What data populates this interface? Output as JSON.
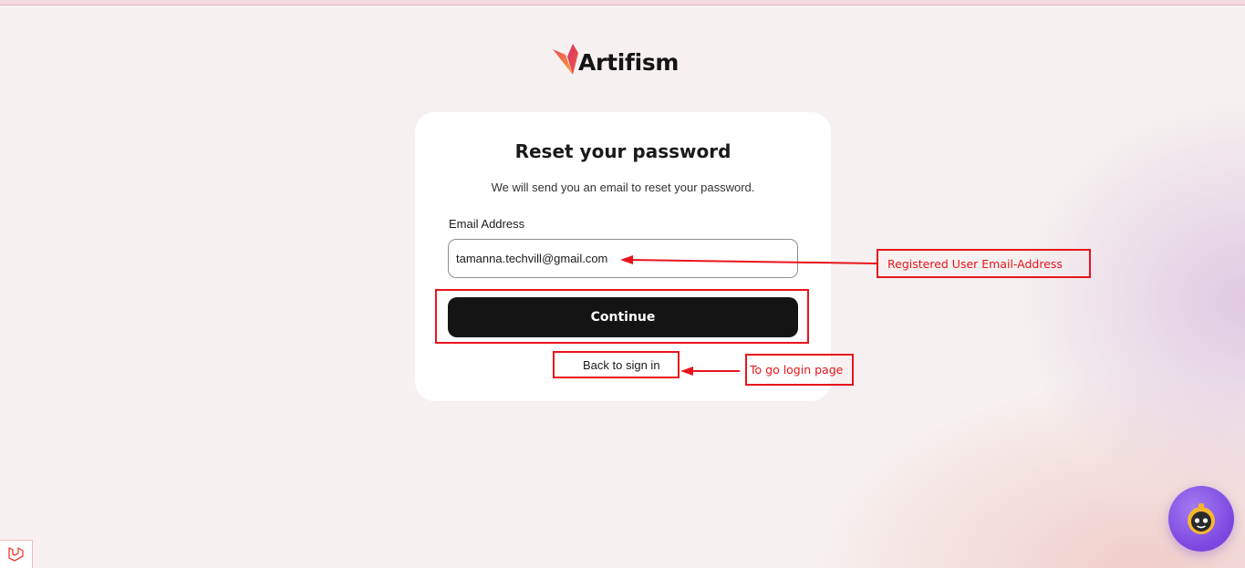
{
  "brand": {
    "name": "Artifism"
  },
  "form": {
    "title": "Reset your password",
    "subtitle": "We will send you an email to reset your password.",
    "email_label": "Email Address",
    "email_value": "tamanna.techvill@gmail.com",
    "continue_label": "Continue",
    "back_label": "Back to sign in"
  },
  "annotations": {
    "email_note": "Registered User Email-Address",
    "back_note": "To go login page",
    "color": "#e8141c"
  },
  "icons": {
    "chat": "chatbot-icon",
    "debug": "laravel-icon"
  },
  "colors": {
    "button": "#141414",
    "background": "#f6f1f0",
    "chat_bubble": "#8b5cf0"
  }
}
